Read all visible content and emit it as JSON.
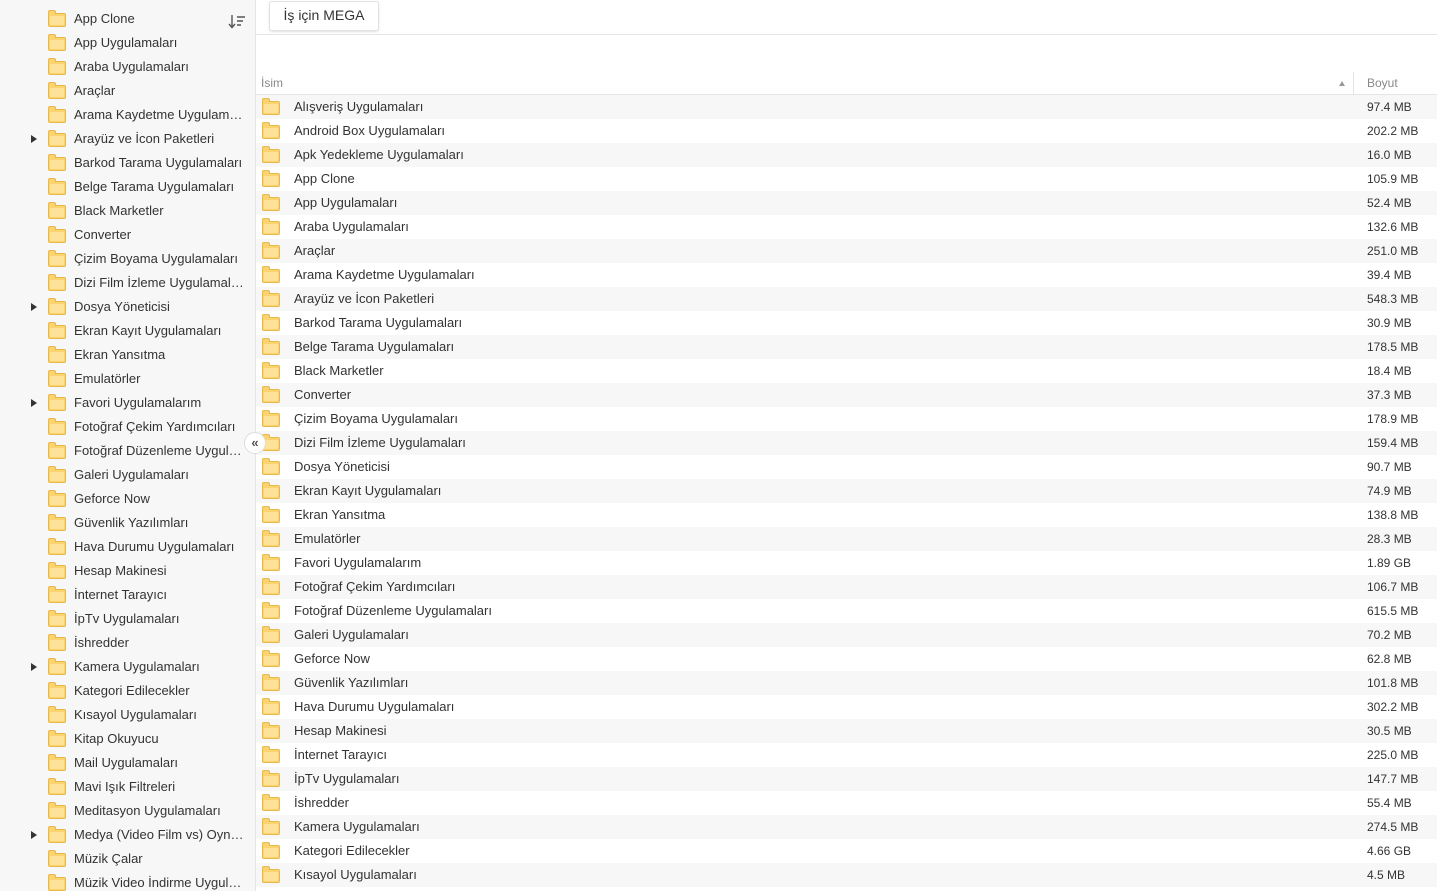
{
  "sidebar": {
    "collapse_glyph": "«",
    "items": [
      {
        "label": "App Clone",
        "expandable": false
      },
      {
        "label": "App Uygulamaları",
        "expandable": false
      },
      {
        "label": "Araba Uygulamaları",
        "expandable": false
      },
      {
        "label": "Araçlar",
        "expandable": false
      },
      {
        "label": "Arama Kaydetme Uygulamaları",
        "expandable": false
      },
      {
        "label": "Arayüz ve İcon Paketleri",
        "expandable": true
      },
      {
        "label": "Barkod Tarama Uygulamaları",
        "expandable": false
      },
      {
        "label": "Belge Tarama Uygulamaları",
        "expandable": false
      },
      {
        "label": "Black Marketler",
        "expandable": false
      },
      {
        "label": "Converter",
        "expandable": false
      },
      {
        "label": "Çizim Boyama Uygulamaları",
        "expandable": false
      },
      {
        "label": "Dizi Film İzleme Uygulamaları",
        "expandable": false
      },
      {
        "label": "Dosya Yöneticisi",
        "expandable": true
      },
      {
        "label": "Ekran Kayıt Uygulamaları",
        "expandable": false
      },
      {
        "label": "Ekran Yansıtma",
        "expandable": false
      },
      {
        "label": "Emulatörler",
        "expandable": false
      },
      {
        "label": "Favori Uygulamalarım",
        "expandable": true
      },
      {
        "label": "Fotoğraf Çekim Yardımcıları",
        "expandable": false
      },
      {
        "label": "Fotoğraf Düzenleme Uygulamaları",
        "expandable": false
      },
      {
        "label": "Galeri Uygulamaları",
        "expandable": false
      },
      {
        "label": "Geforce Now",
        "expandable": false
      },
      {
        "label": "Güvenlik Yazılımları",
        "expandable": false
      },
      {
        "label": "Hava Durumu Uygulamaları",
        "expandable": false
      },
      {
        "label": "Hesap Makinesi",
        "expandable": false
      },
      {
        "label": "İnternet Tarayıcı",
        "expandable": false
      },
      {
        "label": "İpTv Uygulamaları",
        "expandable": false
      },
      {
        "label": "İshredder",
        "expandable": false
      },
      {
        "label": "Kamera Uygulamaları",
        "expandable": true
      },
      {
        "label": "Kategori Edilecekler",
        "expandable": false
      },
      {
        "label": "Kısayol Uygulamaları",
        "expandable": false
      },
      {
        "label": "Kitap Okuyucu",
        "expandable": false
      },
      {
        "label": "Mail Uygulamaları",
        "expandable": false
      },
      {
        "label": "Mavi Işık Filtreleri",
        "expandable": false
      },
      {
        "label": "Meditasyon Uygulamaları",
        "expandable": false
      },
      {
        "label": "Medya (Video Film vs) Oynatıcılar",
        "expandable": true
      },
      {
        "label": "Müzik Çalar",
        "expandable": false
      },
      {
        "label": "Müzik Video İndirme Uygulamaları",
        "expandable": false
      }
    ]
  },
  "toolbar": {
    "mega_button": "İş için MEGA"
  },
  "table": {
    "col_name": "İsim",
    "col_size": "Boyut",
    "rows": [
      {
        "name": "Alışveriş Uygulamaları",
        "size": "97.4 MB"
      },
      {
        "name": "Android Box Uygulamaları",
        "size": "202.2 MB"
      },
      {
        "name": "Apk Yedekleme Uygulamaları",
        "size": "16.0 MB"
      },
      {
        "name": "App Clone",
        "size": "105.9 MB"
      },
      {
        "name": "App Uygulamaları",
        "size": "52.4 MB"
      },
      {
        "name": "Araba Uygulamaları",
        "size": "132.6 MB"
      },
      {
        "name": "Araçlar",
        "size": "251.0 MB"
      },
      {
        "name": "Arama Kaydetme Uygulamaları",
        "size": "39.4 MB"
      },
      {
        "name": "Arayüz ve İcon Paketleri",
        "size": "548.3 MB"
      },
      {
        "name": "Barkod Tarama Uygulamaları",
        "size": "30.9 MB"
      },
      {
        "name": "Belge Tarama Uygulamaları",
        "size": "178.5 MB"
      },
      {
        "name": "Black Marketler",
        "size": "18.4 MB"
      },
      {
        "name": "Converter",
        "size": "37.3 MB"
      },
      {
        "name": "Çizim Boyama Uygulamaları",
        "size": "178.9 MB"
      },
      {
        "name": "Dizi Film İzleme Uygulamaları",
        "size": "159.4 MB"
      },
      {
        "name": "Dosya Yöneticisi",
        "size": "90.7 MB"
      },
      {
        "name": "Ekran Kayıt Uygulamaları",
        "size": "74.9 MB"
      },
      {
        "name": "Ekran Yansıtma",
        "size": "138.8 MB"
      },
      {
        "name": "Emulatörler",
        "size": "28.3 MB"
      },
      {
        "name": "Favori Uygulamalarım",
        "size": "1.89 GB"
      },
      {
        "name": "Fotoğraf Çekim Yardımcıları",
        "size": "106.7 MB"
      },
      {
        "name": "Fotoğraf Düzenleme Uygulamaları",
        "size": "615.5 MB"
      },
      {
        "name": "Galeri Uygulamaları",
        "size": "70.2 MB"
      },
      {
        "name": "Geforce Now",
        "size": "62.8 MB"
      },
      {
        "name": "Güvenlik Yazılımları",
        "size": "101.8 MB"
      },
      {
        "name": "Hava Durumu Uygulamaları",
        "size": "302.2 MB"
      },
      {
        "name": "Hesap Makinesi",
        "size": "30.5 MB"
      },
      {
        "name": "İnternet Tarayıcı",
        "size": "225.0 MB"
      },
      {
        "name": "İpTv Uygulamaları",
        "size": "147.7 MB"
      },
      {
        "name": "İshredder",
        "size": "55.4 MB"
      },
      {
        "name": "Kamera Uygulamaları",
        "size": "274.5 MB"
      },
      {
        "name": "Kategori Edilecekler",
        "size": "4.66 GB"
      },
      {
        "name": "Kısayol Uygulamaları",
        "size": "4.5 MB"
      }
    ]
  }
}
